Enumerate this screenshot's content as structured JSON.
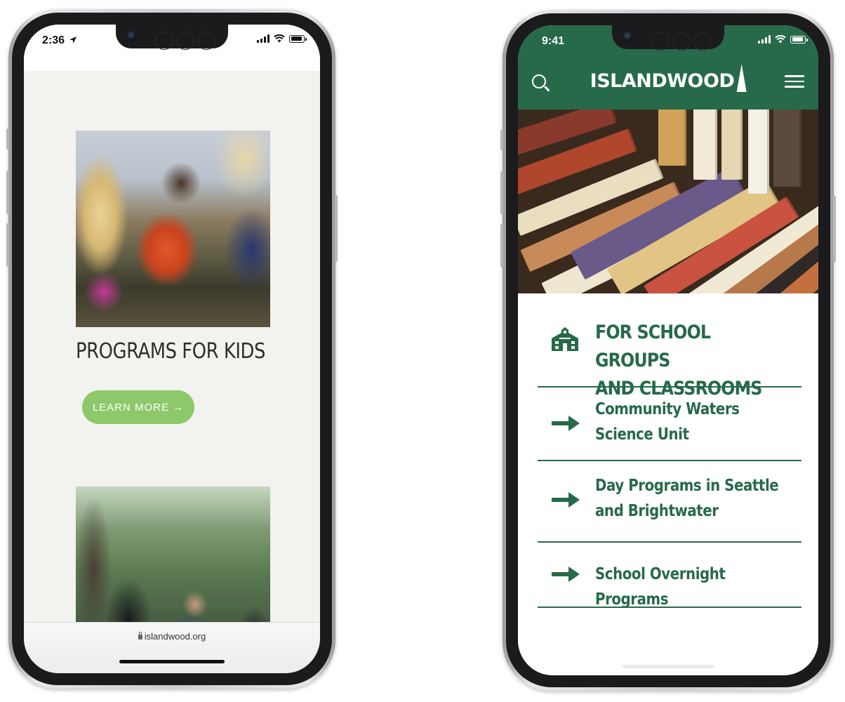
{
  "left_phone": {
    "status": {
      "time": "2:36"
    },
    "page": {
      "title": "PROGRAMS FOR KIDS",
      "button_label": "LEARN MORE →"
    },
    "browser": {
      "url": "islandwood.org"
    }
  },
  "right_phone": {
    "status": {
      "time": "9:41"
    },
    "header": {
      "logo_text": "ISLANDWOOD"
    },
    "section": {
      "title_line1": "FOR SCHOOL GROUPS",
      "title_line2": "AND CLASSROOMS",
      "items": [
        {
          "line1": "Community Waters",
          "line2": "Science Unit"
        },
        {
          "line1": "Day Programs in Seattle",
          "line2": "and Brightwater"
        },
        {
          "line1": "School Overnight Programs",
          "line2": ""
        }
      ]
    },
    "colors": {
      "brand_green": "#266a4a",
      "header_green": "#266a4a"
    }
  },
  "colors": {
    "button_green": "#8dc86a",
    "page_bg": "#f2f2ef"
  },
  "icons": [
    "location-arrow-icon",
    "signal-icon",
    "wifi-icon",
    "battery-icon",
    "search-icon",
    "menu-icon",
    "tree-logo-icon",
    "school-building-icon",
    "arrow-right-icon",
    "lock-icon"
  ]
}
